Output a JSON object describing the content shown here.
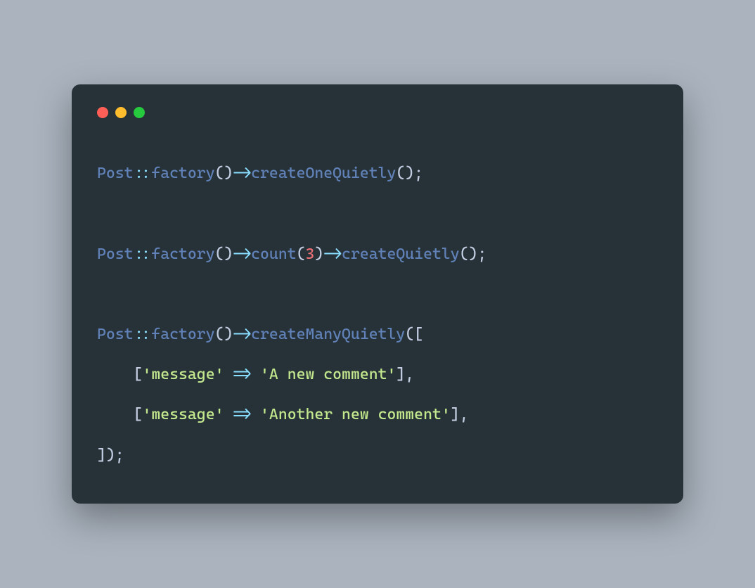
{
  "colors": {
    "background": "#aab3be",
    "editor": "#263238",
    "traffic_red": "#ff5f56",
    "traffic_yellow": "#ffbd2e",
    "traffic_green": "#27c93f",
    "class": "#6182b8",
    "operator": "#89ddff",
    "method": "#6182b8",
    "punctuation": "#c3cee3",
    "number": "#f07178",
    "string": "#c3e88d"
  },
  "traffic": {
    "red_name": "close-icon",
    "yellow_name": "minimize-icon",
    "green_name": "zoom-icon"
  },
  "code": {
    "lines": [
      {
        "indent": "",
        "tokens": [
          {
            "t": "class",
            "v": "Post"
          },
          {
            "t": "op",
            "v": "::"
          },
          {
            "t": "method",
            "v": "factory"
          },
          {
            "t": "punc",
            "v": "()"
          },
          {
            "t": "op",
            "v": "->"
          },
          {
            "t": "method",
            "v": "createOneQuietly"
          },
          {
            "t": "punc",
            "v": "();"
          }
        ]
      },
      {
        "blank": true
      },
      {
        "indent": "",
        "tokens": [
          {
            "t": "class",
            "v": "Post"
          },
          {
            "t": "op",
            "v": "::"
          },
          {
            "t": "method",
            "v": "factory"
          },
          {
            "t": "punc",
            "v": "()"
          },
          {
            "t": "op",
            "v": "->"
          },
          {
            "t": "method",
            "v": "count"
          },
          {
            "t": "punc",
            "v": "("
          },
          {
            "t": "num",
            "v": "3"
          },
          {
            "t": "punc",
            "v": ")"
          },
          {
            "t": "op",
            "v": "->"
          },
          {
            "t": "method",
            "v": "createQuietly"
          },
          {
            "t": "punc",
            "v": "();"
          }
        ]
      },
      {
        "blank": true
      },
      {
        "indent": "",
        "tokens": [
          {
            "t": "class",
            "v": "Post"
          },
          {
            "t": "op",
            "v": "::"
          },
          {
            "t": "method",
            "v": "factory"
          },
          {
            "t": "punc",
            "v": "()"
          },
          {
            "t": "op",
            "v": "->"
          },
          {
            "t": "method",
            "v": "createManyQuietly"
          },
          {
            "t": "punc",
            "v": "(["
          }
        ]
      },
      {
        "indent": "    ",
        "tokens": [
          {
            "t": "punc",
            "v": "["
          },
          {
            "t": "str",
            "v": "'message'"
          },
          {
            "t": "punc",
            "v": " "
          },
          {
            "t": "op",
            "v": "=>"
          },
          {
            "t": "punc",
            "v": " "
          },
          {
            "t": "str",
            "v": "'A new comment'"
          },
          {
            "t": "punc",
            "v": "],"
          }
        ]
      },
      {
        "indent": "    ",
        "tokens": [
          {
            "t": "punc",
            "v": "["
          },
          {
            "t": "str",
            "v": "'message'"
          },
          {
            "t": "punc",
            "v": " "
          },
          {
            "t": "op",
            "v": "=>"
          },
          {
            "t": "punc",
            "v": " "
          },
          {
            "t": "str",
            "v": "'Another new comment'"
          },
          {
            "t": "punc",
            "v": "],"
          }
        ]
      },
      {
        "indent": "",
        "tokens": [
          {
            "t": "punc",
            "v": "]);"
          }
        ]
      }
    ]
  }
}
